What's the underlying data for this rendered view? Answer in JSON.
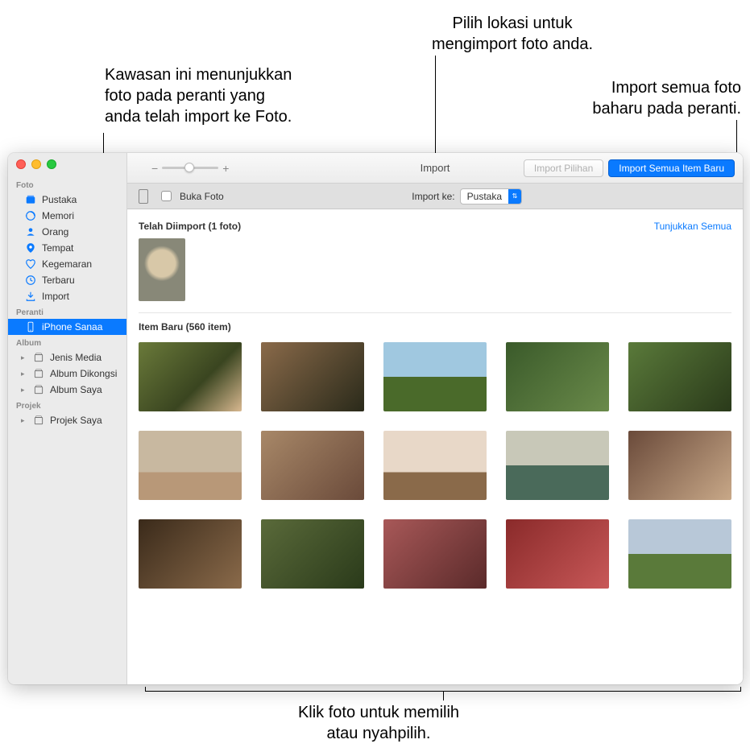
{
  "callouts": {
    "imported_area": "Kawasan ini menunjukkan\nfoto pada peranti yang\nanda telah import ke Foto.",
    "location": "Pilih lokasi untuk\nmengimport foto anda.",
    "import_all": "Import semua foto\nbaharu pada peranti.",
    "select_photo": "Klik foto untuk memilih\natau nyahpilih."
  },
  "toolbar": {
    "title": "Import",
    "import_selected": "Import Pilihan",
    "import_all_new": "Import Semua Item Baru"
  },
  "subbar": {
    "open_photos": "Buka Foto",
    "import_to_label": "Import ke:",
    "import_to_value": "Pustaka"
  },
  "sidebar": {
    "sections": {
      "foto": "Foto",
      "peranti": "Peranti",
      "album": "Album",
      "projek": "Projek"
    },
    "items": {
      "pustaka": "Pustaka",
      "memori": "Memori",
      "orang": "Orang",
      "tempat": "Tempat",
      "kegemaran": "Kegemaran",
      "terbaru": "Terbaru",
      "import": "Import",
      "device": "iPhone Sanaa",
      "jenis_media": "Jenis Media",
      "album_dikongsi": "Album Dikongsi",
      "album_saya": "Album Saya",
      "projek_saya": "Projek Saya"
    }
  },
  "content": {
    "imported_title": "Telah Diimport (1 foto)",
    "show_all": "Tunjukkan Semua",
    "new_items_title": "Item Baru (560 item)"
  }
}
